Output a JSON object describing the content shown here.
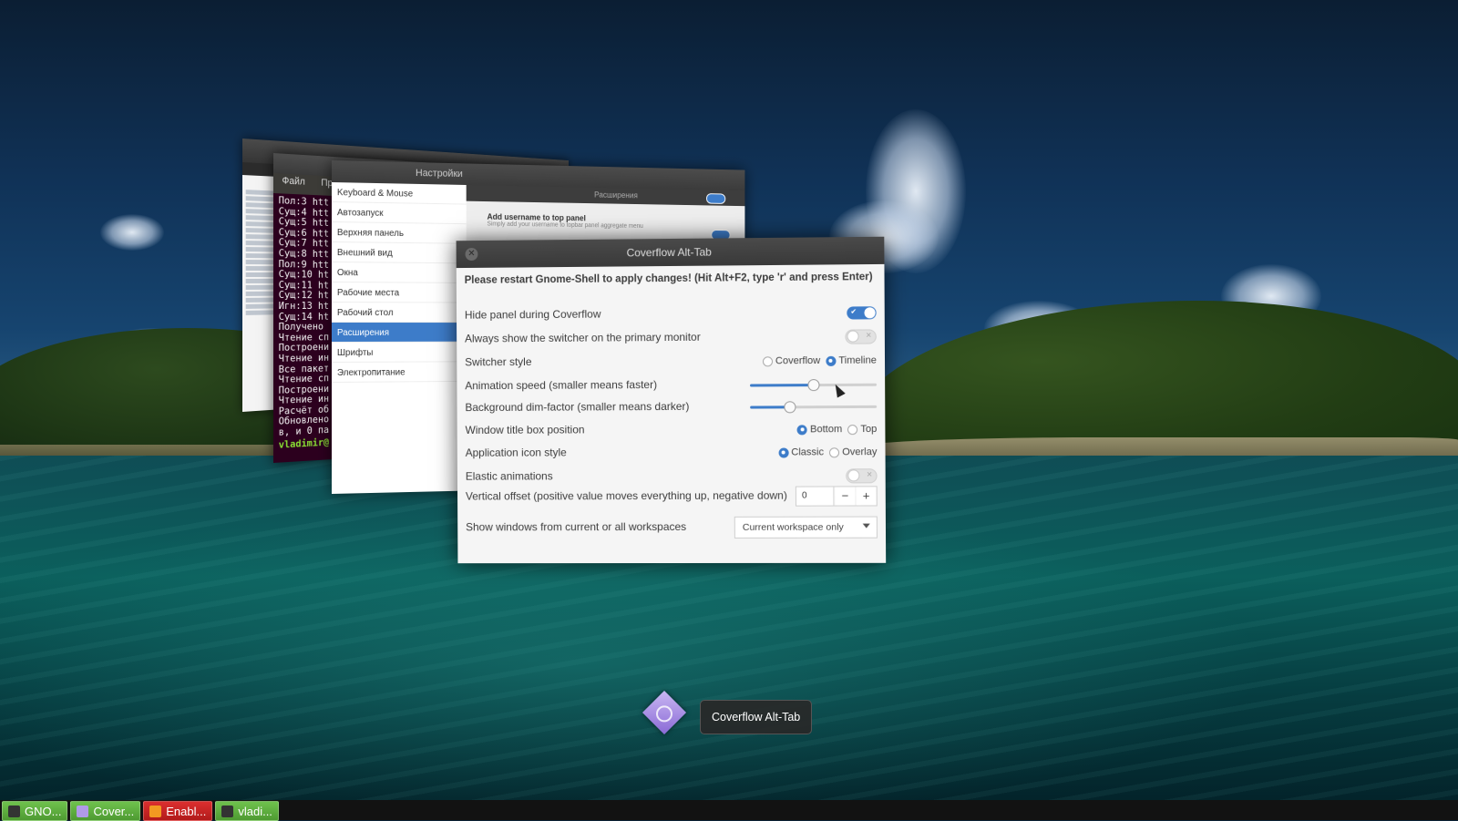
{
  "background_windows": {
    "terminal": {
      "menu": [
        "Файл",
        "Пр"
      ],
      "lines": [
        "Пол:3 htt",
        "Сущ:4 htt",
        "Сущ:5 htt",
        "Сущ:6 htt",
        "Сущ:7 htt",
        "Сущ:8 htt",
        "Пол:9 htt",
        "Сущ:10 ht",
        "Сущ:11 ht",
        "Сущ:12 ht",
        "Игн:13 ht",
        "Сущ:14 ht",
        "Получено",
        "Чтение сп",
        "Построени",
        "Чтение ин",
        "Все пакет",
        "Чтение сп",
        "Построени",
        "Чтение ин",
        "Расчёт об",
        "Обновлено",
        "в, и 0 па"
      ],
      "prompt": "vladimir@"
    },
    "settings": {
      "title": "Настройки",
      "section_title": "Расширения",
      "sidebar": [
        "Keyboard & Mouse",
        "Автозапуск",
        "Верхняя панель",
        "Внешний вид",
        "Окна",
        "Рабочие места",
        "Рабочий стол",
        "Расширения",
        "Шрифты",
        "Электропитание"
      ],
      "active_index": 7,
      "extension_name": "Add username to top panel",
      "extension_desc": "Simply add your username to topbar panel aggregate menu"
    }
  },
  "dialog": {
    "title": "Coverflow Alt-Tab",
    "notice": "Please restart Gnome-Shell to apply changes! (Hit Alt+F2, type 'r' and press Enter)",
    "hide_panel": {
      "label": "Hide panel during Coverflow",
      "on": true
    },
    "primary_monitor": {
      "label": "Always show the switcher on the primary monitor",
      "on": false
    },
    "switcher_style": {
      "label": "Switcher style",
      "options": [
        "Coverflow",
        "Timeline"
      ],
      "selected": "Timeline"
    },
    "animation_speed": {
      "label": "Animation speed (smaller means faster)",
      "level": 0.5
    },
    "dim_factor": {
      "label": "Background dim-factor (smaller means darker)",
      "level": 0.31
    },
    "title_position": {
      "label": "Window title box position",
      "options": [
        "Bottom",
        "Top"
      ],
      "selected": "Bottom"
    },
    "icon_style": {
      "label": "Application icon style",
      "options": [
        "Classic",
        "Overlay"
      ],
      "selected": "Classic"
    },
    "elastic": {
      "label": "Elastic animations",
      "on": false
    },
    "vertical_offset": {
      "label": "Vertical offset (positive value moves everything up, negative down)",
      "value": "0",
      "minus": "−",
      "plus": "+"
    },
    "workspaces": {
      "label": "Show windows from current or all workspaces",
      "selected": "Current workspace only"
    },
    "toggle_on_mark": "✔",
    "toggle_off_mark": "✕"
  },
  "switcher_label": "Coverflow Alt-Tab",
  "taskbar": [
    {
      "label": "GNO...",
      "color": "#5aa83c"
    },
    {
      "label": "Cover...",
      "color": "#5aa83c"
    },
    {
      "label": "Enabl...",
      "color": "#c92424"
    },
    {
      "label": "vladi...",
      "color": "#5aa83c"
    }
  ]
}
